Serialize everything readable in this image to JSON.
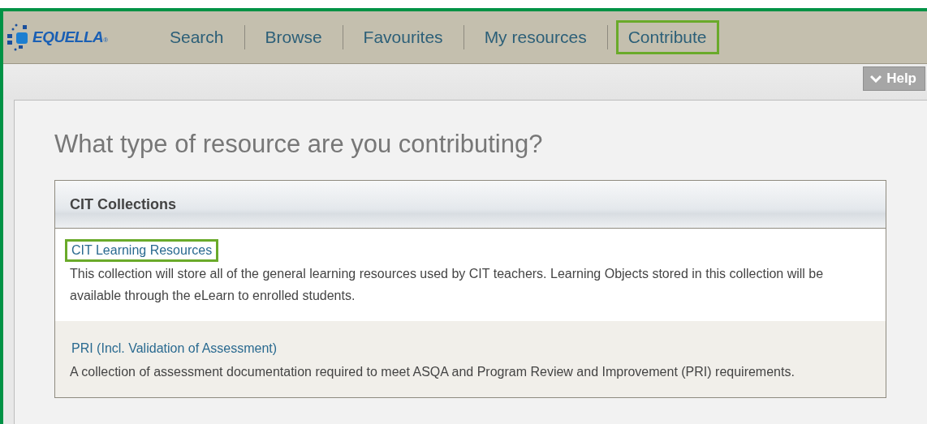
{
  "logo": {
    "text": "EQUELLA",
    "mark": "®"
  },
  "nav": [
    {
      "label": "Search",
      "highlighted": false
    },
    {
      "label": "Browse",
      "highlighted": false
    },
    {
      "label": "Favourites",
      "highlighted": false
    },
    {
      "label": "My resources",
      "highlighted": false
    },
    {
      "label": "Contribute",
      "highlighted": true
    }
  ],
  "help_button": "Help",
  "heading": "What type of resource are you contributing?",
  "collections": {
    "title": "CIT Collections",
    "items": [
      {
        "name": "CIT Learning Resources",
        "highlighted": true,
        "description": "This collection will store all of the general learning resources used by CIT teachers. Learning Objects stored in this collection will be available through the eLearn to enrolled students."
      },
      {
        "name": "PRI (Incl. Validation of Assessment)",
        "highlighted": false,
        "description": "A collection of assessment documentation required to meet ASQA and Program Review and Improvement (PRI) requirements."
      }
    ]
  }
}
